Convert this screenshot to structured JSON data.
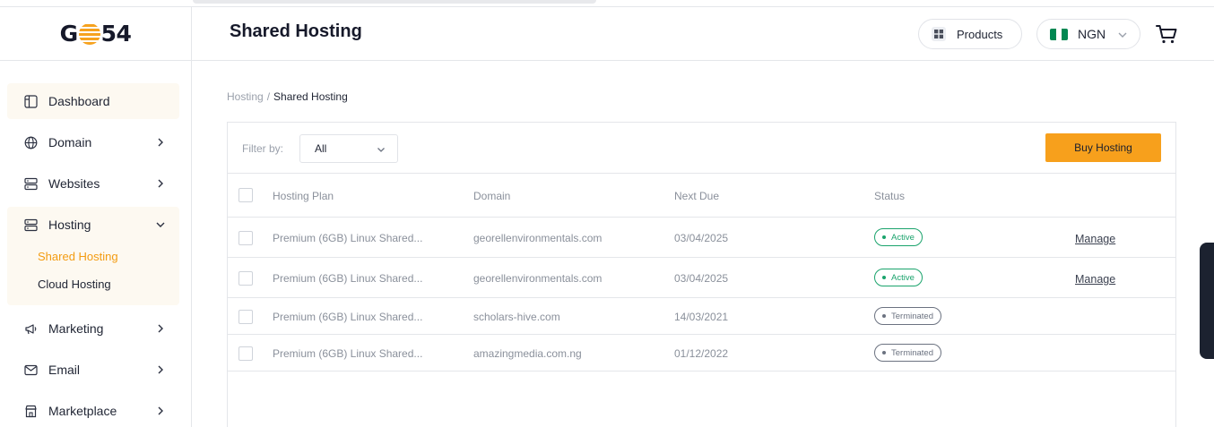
{
  "logo": {
    "prefix": "G",
    "suffix": "54"
  },
  "sidebar": {
    "items": [
      {
        "label": "Dashboard"
      },
      {
        "label": "Domain"
      },
      {
        "label": "Websites"
      },
      {
        "label": "Hosting"
      },
      {
        "label": "Marketing"
      },
      {
        "label": "Email"
      },
      {
        "label": "Marketplace"
      }
    ],
    "hosting_sub": [
      {
        "label": "Shared Hosting"
      },
      {
        "label": "Cloud Hosting"
      }
    ]
  },
  "header": {
    "title": "Shared Hosting",
    "products_label": "Products",
    "currency_label": "NGN"
  },
  "breadcrumb": {
    "parent": "Hosting",
    "separator": "/",
    "current": "Shared Hosting"
  },
  "filter": {
    "label": "Filter by:",
    "selected": "All"
  },
  "buy_button": "Buy Hosting",
  "table": {
    "columns": {
      "plan": "Hosting Plan",
      "domain": "Domain",
      "due": "Next Due",
      "status": "Status"
    },
    "rows": [
      {
        "plan": "Premium (6GB) Linux Shared...",
        "domain": "georellenvironmentals.com",
        "due": "03/04/2025",
        "status": "Active",
        "action": "Manage"
      },
      {
        "plan": "Premium (6GB) Linux Shared...",
        "domain": "georellenvironmentals.com",
        "due": "03/04/2025",
        "status": "Active",
        "action": "Manage"
      },
      {
        "plan": "Premium (6GB) Linux Shared...",
        "domain": "scholars-hive.com",
        "due": "14/03/2021",
        "status": "Terminated"
      },
      {
        "plan": "Premium (6GB) Linux Shared...",
        "domain": "amazingmedia.com.ng",
        "due": "01/12/2022",
        "status": "Terminated"
      }
    ]
  },
  "colors": {
    "accent": "#f7a01c",
    "active_green": "#1aa36c",
    "terminated_gray": "#6b7280",
    "flag_green": "#008751"
  }
}
